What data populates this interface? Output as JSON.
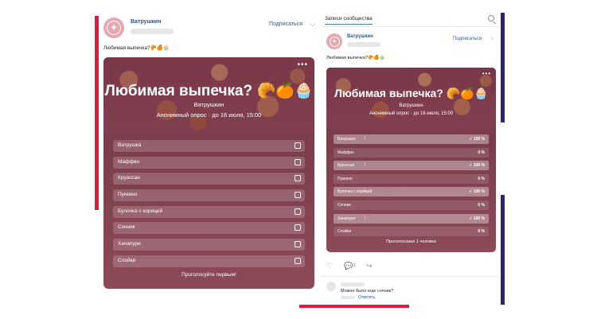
{
  "left_post": {
    "author": "Ватрушкин",
    "subscribe": "Подписаться",
    "text": "Любимая выпечка?🥐🍊🧁",
    "poll": {
      "title": "Любимая выпечка?",
      "title_emoji": [
        "🥐",
        "🍊",
        "🧁"
      ],
      "author": "Ватрушкин",
      "meta": "Анонимный опрос · до 16 июля, 15:00",
      "more": "•••",
      "options": [
        {
          "label": "Ватрушка"
        },
        {
          "label": "Маффин"
        },
        {
          "label": "Круассан"
        },
        {
          "label": "Пуккино"
        },
        {
          "label": "Булочка с корицей"
        },
        {
          "label": "Сочник"
        },
        {
          "label": "Хачапури"
        },
        {
          "label": "Слойки"
        }
      ],
      "footer": "Проголосуйте первым!"
    }
  },
  "right_panel": {
    "search_tab": "Записи сообщества",
    "post": {
      "author": "Ватрушкин",
      "subscribe": "Подписаться",
      "text": "Любимая выпечка?🥐🍊🧁",
      "poll": {
        "title": "Любимая выпечка?",
        "title_emoji": [
          "🥐",
          "🍊",
          "🧁"
        ],
        "author": "Ватрушкин",
        "meta": "Анонимный опрос · до 16 июля, 15:00",
        "more": "•••",
        "options": [
          {
            "label": "Ватрушка",
            "mark": "1",
            "pct": "✓ 100 %",
            "fill": 1.0
          },
          {
            "label": "Маффин",
            "mark": "",
            "pct": "0 %",
            "fill": 0
          },
          {
            "label": "Круассан",
            "mark": "1",
            "pct": "✓ 100 %",
            "fill": 1.0
          },
          {
            "label": "Пуккино",
            "mark": "",
            "pct": "0 %",
            "fill": 0
          },
          {
            "label": "Булочка с корицей",
            "mark": "1",
            "pct": "✓ 100 %",
            "fill": 1.0
          },
          {
            "label": "Сочник",
            "mark": "",
            "pct": "0 %",
            "fill": 0
          },
          {
            "label": "Хачапури",
            "mark": "1",
            "pct": "✓ 100 %",
            "fill": 1.0
          },
          {
            "label": "Слойки",
            "mark": "",
            "pct": "0 %",
            "fill": 0
          }
        ],
        "footer": "Проголосовал 1 человек"
      },
      "actions": {
        "like_icon": "heart-icon",
        "comment_icon": "comment-icon",
        "comment_count": "1",
        "share_icon": "share-icon"
      }
    },
    "comment": {
      "text": "Можно было еще сочник?",
      "reply": "Ответить"
    }
  },
  "colors": {
    "accent_red": "#e3193b",
    "accent_navy": "#2b2670",
    "poll_bg": "#8a4555",
    "link": "#2a5885"
  }
}
